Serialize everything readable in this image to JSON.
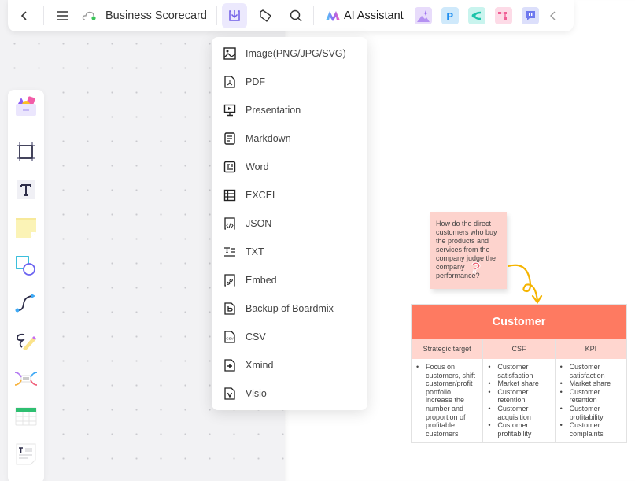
{
  "toolbar": {
    "back_icon": "chevron-left-icon",
    "menu_icon": "hamburger-icon",
    "sync_icon": "cloud-synced-icon",
    "doc_title": "Business Scorecard",
    "export_icon": "download-icon",
    "tag_icon": "tag-icon",
    "search_icon": "search-icon",
    "ai_label": "AI Assistant",
    "apps": [
      {
        "name": "ai-image-app",
        "color": "#e8dcfb"
      },
      {
        "name": "ai-presentation-app",
        "color": "#cfe9fb"
      },
      {
        "name": "ai-mindmap-app",
        "color": "#c9f4ee"
      },
      {
        "name": "ai-flowchart-app",
        "color": "#fddbe7"
      },
      {
        "name": "ai-chat-app",
        "color": "#dcdffb"
      }
    ],
    "collapse_icon": "chevron-left-icon"
  },
  "left_tools": [
    {
      "name": "templates-tool"
    },
    {
      "name": "frame-tool"
    },
    {
      "name": "text-tool"
    },
    {
      "name": "sticky-note-tool"
    },
    {
      "name": "shapes-tool"
    },
    {
      "name": "connector-tool"
    },
    {
      "name": "pen-tool"
    },
    {
      "name": "mindmap-tool"
    },
    {
      "name": "table-tool"
    },
    {
      "name": "document-tool"
    }
  ],
  "export_menu": {
    "items": [
      {
        "label": "Image(PNG/JPG/SVG)",
        "icon": "image-icon"
      },
      {
        "label": "PDF",
        "icon": "pdf-icon"
      },
      {
        "label": "Presentation",
        "icon": "presentation-icon"
      },
      {
        "label": "Markdown",
        "icon": "markdown-icon"
      },
      {
        "label": "Word",
        "icon": "word-icon"
      },
      {
        "label": "EXCEL",
        "icon": "excel-icon"
      },
      {
        "label": "JSON",
        "icon": "json-icon"
      },
      {
        "label": "TXT",
        "icon": "txt-icon"
      },
      {
        "label": "Embed",
        "icon": "embed-icon"
      },
      {
        "label": "Backup of Boardmix",
        "icon": "boardmix-icon"
      },
      {
        "label": "CSV",
        "icon": "csv-icon"
      },
      {
        "label": "Xmind",
        "icon": "xmind-icon"
      },
      {
        "label": "Visio",
        "icon": "visio-icon"
      }
    ]
  },
  "board": {
    "sticky_text": "How do the direct customers who buy the products and services from the company judge the company performance?",
    "sticky_mark": "?",
    "table": {
      "title": "Customer",
      "columns": [
        "Strategic target",
        "CSF",
        "KPI"
      ],
      "cells": [
        [
          "Focus on customers, shift customer/profit portfolio, increase the number and proportion of profitable customers"
        ],
        [
          "Customer satisfaction",
          "Market share",
          "Customer retention",
          "Customer acquisition",
          "Customer profitability"
        ],
        [
          "Customer satisfaction",
          "Market share",
          "Customer retention",
          "Customer profitability",
          "Customer complaints"
        ]
      ]
    }
  }
}
